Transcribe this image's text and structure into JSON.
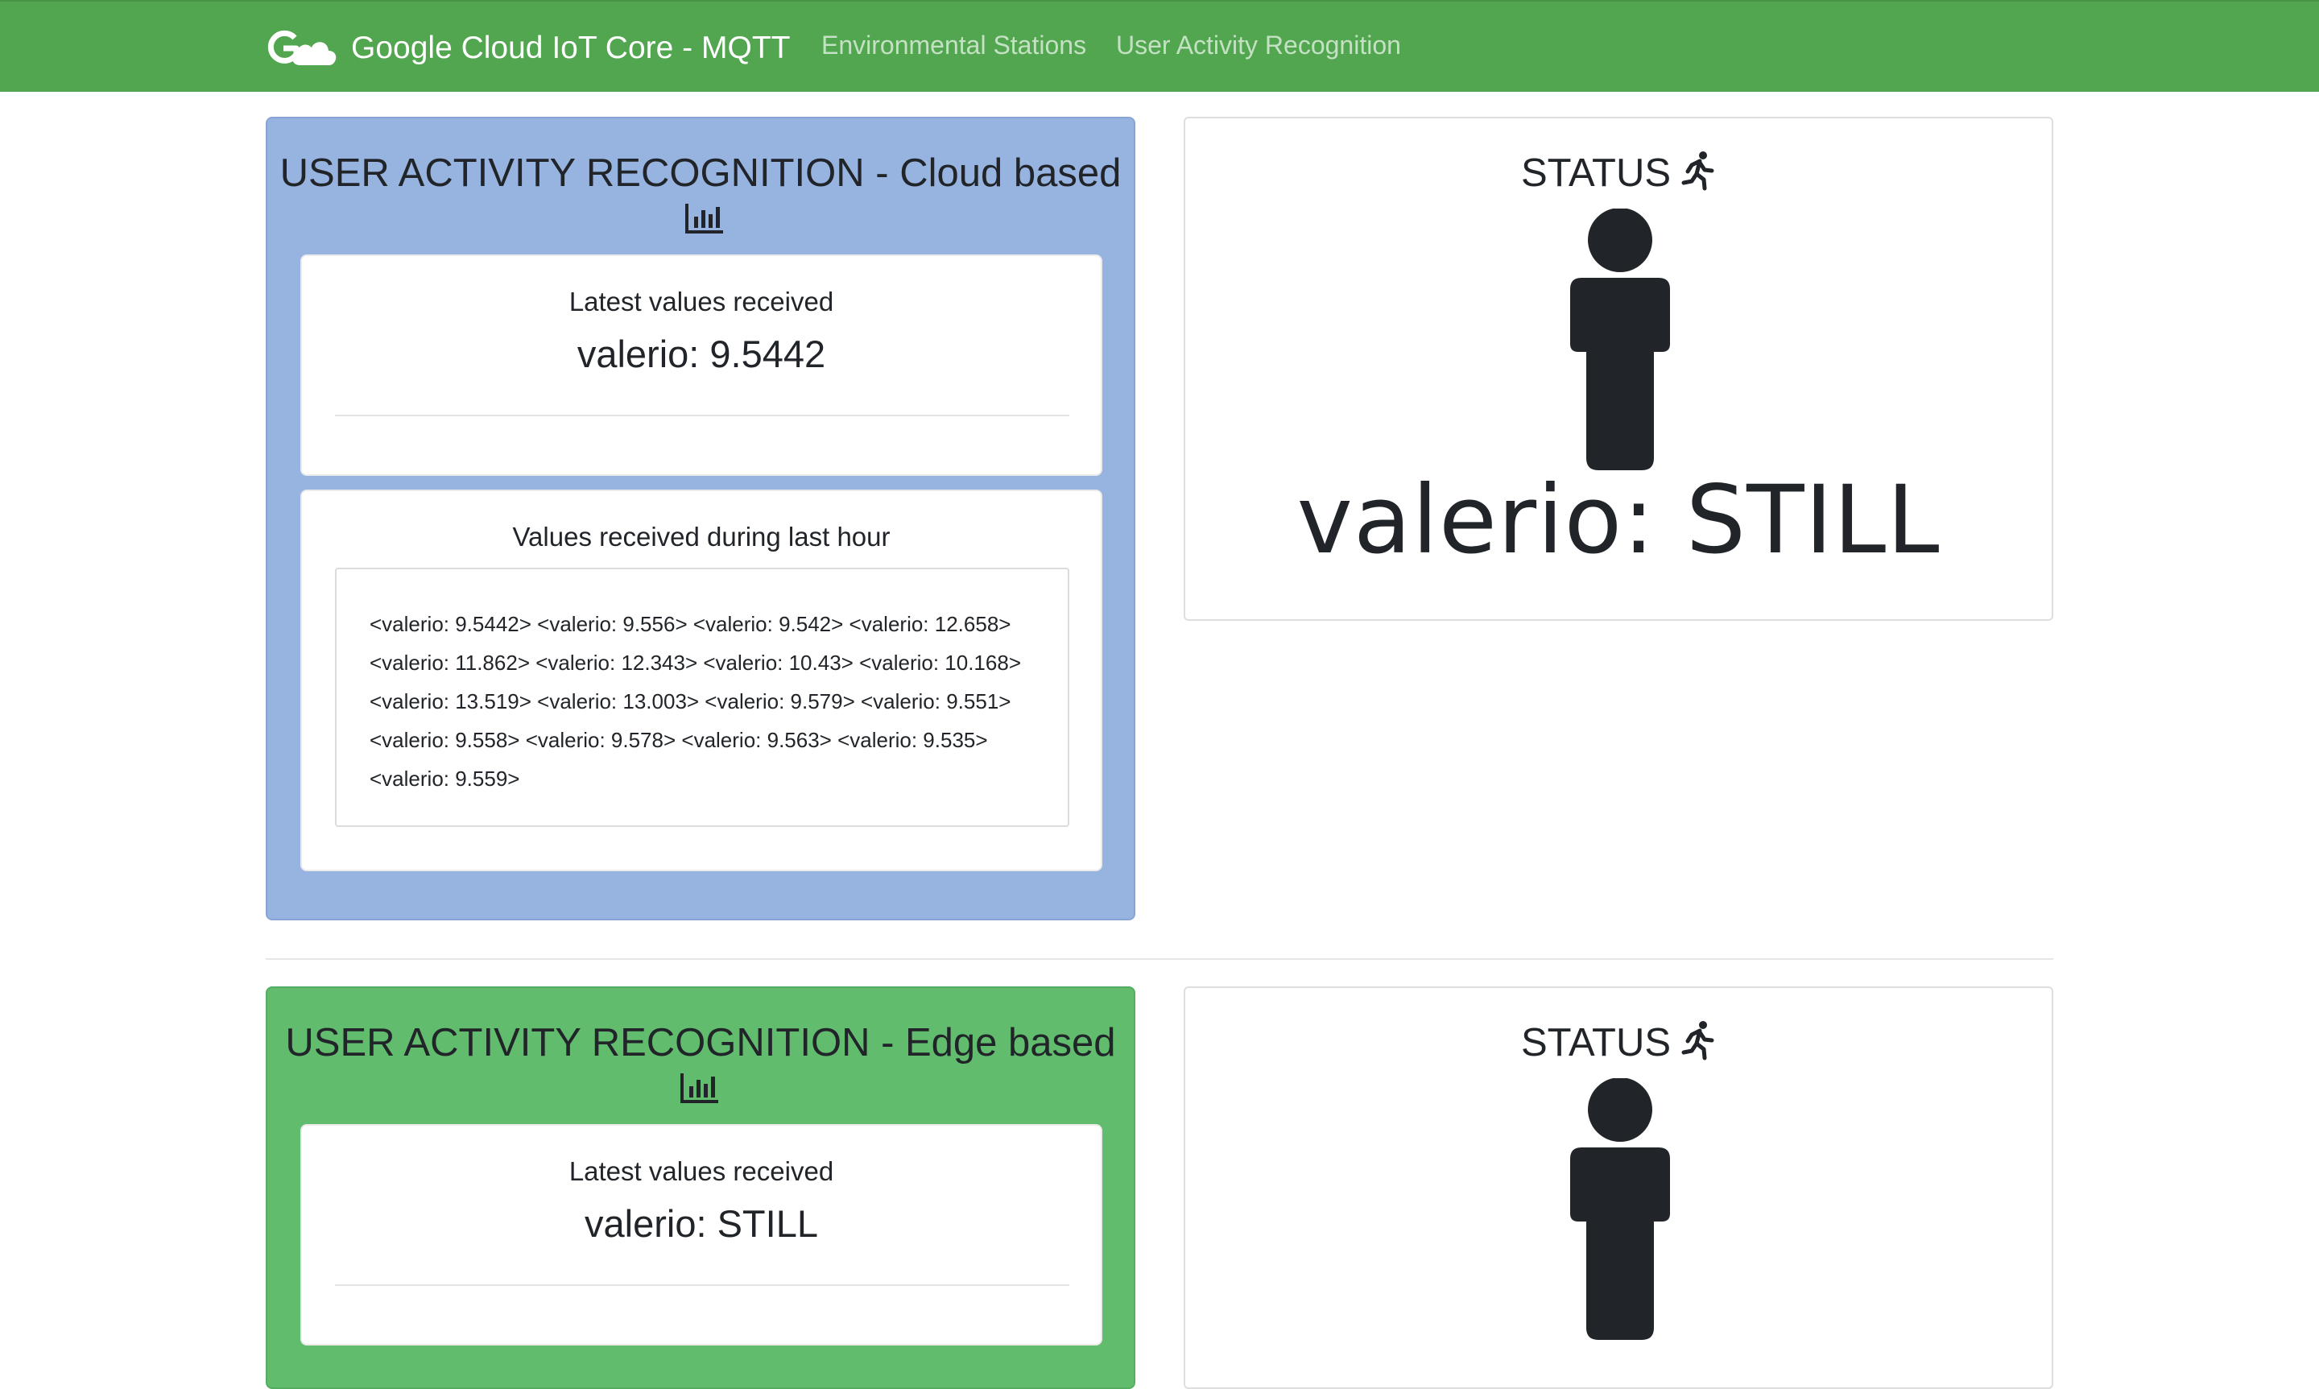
{
  "navbar": {
    "brand_icon": "google-cloud-logo-icon",
    "brand": "Google Cloud IoT Core - MQTT",
    "links": [
      "Environmental Stations",
      "User Activity Recognition"
    ],
    "bg_color": "#52a650"
  },
  "cloud_panel": {
    "title": "USER ACTIVITY RECOGNITION - Cloud based",
    "title_icon": "bar-chart-icon",
    "bg_color": "#97b4e0",
    "latest": {
      "heading": "Latest values received",
      "value": "valerio: 9.5442"
    },
    "last_hour": {
      "heading": "Values received during last hour",
      "values": "<valerio: 9.5442> <valerio: 9.556> <valerio: 9.542> <valerio: 12.658> <valerio: 11.862> <valerio: 12.343> <valerio: 10.43> <valerio: 10.168> <valerio: 13.519> <valerio: 13.003> <valerio: 9.579> <valerio: 9.551> <valerio: 9.558> <valerio: 9.578> <valerio: 9.563> <valerio: 9.535> <valerio: 9.559>"
    }
  },
  "cloud_status": {
    "title": "STATUS",
    "title_icon": "running-person-icon",
    "figure_icon": "standing-person-icon",
    "value": "valerio: STILL"
  },
  "edge_panel": {
    "title": "USER ACTIVITY RECOGNITION - Edge based",
    "title_icon": "bar-chart-icon",
    "bg_color": "#62bc6e",
    "latest": {
      "heading": "Latest values received",
      "value": "valerio: STILL"
    }
  },
  "edge_status": {
    "title": "STATUS",
    "title_icon": "running-person-icon",
    "figure_icon": "standing-person-icon"
  }
}
